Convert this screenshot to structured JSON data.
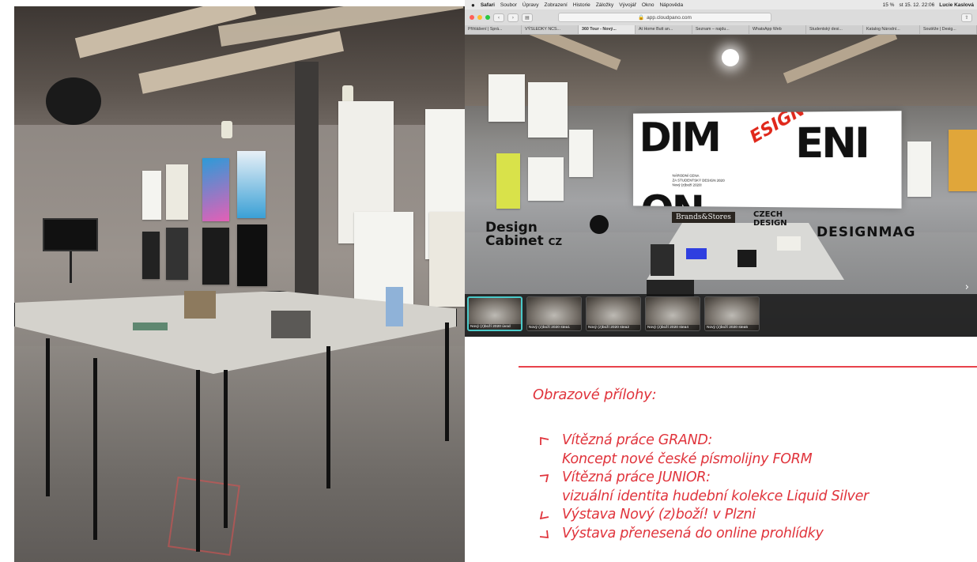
{
  "browser": {
    "menubar": {
      "apple": "",
      "app": "Safari",
      "items": [
        "Soubor",
        "Úpravy",
        "Zobrazení",
        "Historie",
        "Záložky",
        "Vývojář",
        "Okno",
        "Nápověda"
      ],
      "status": [
        "15 %",
        "st 15. 12.  22:06",
        "Lucie Kaslová"
      ]
    },
    "url": "app.cloudpano.com",
    "tabs": [
      "Přihlášení | Sprá...",
      "VÝSLEDKY NCS...",
      "360 Tour - Nový...",
      "At Home Butt an...",
      "Seznam – najdu...",
      "WhatsApp Web",
      "Studentský desi...",
      "Katalog Národní...",
      "Soutěže | Desig..."
    ],
    "active_tab": 2
  },
  "tour": {
    "banner_big_1": "DIM",
    "banner_big_2": "ENI",
    "banner_big_3": "ON",
    "banner_red": "ESIGN",
    "banner_small": "NÁRODNÍ CENA\nZA STUDENTSKÝ DESIGN 2020\nNový (z)boží 2020!",
    "logos": {
      "design_cabinet_1": "Design",
      "design_cabinet_2": "Cabinet",
      "design_cabinet_cz": "CZ",
      "brands_stores": "Brands&Stores",
      "czech_design_1": "CZECH",
      "czech_design_2": "DESIGN",
      "designmag": "DESIGNMAG"
    },
    "thumbnails": [
      "Nový (z)boží 2020 úvod",
      "Nový (z)boží 2020 stea1",
      "Nový (z)boží 2020 stea2",
      "Nový (z)boží 2020 stea4",
      "Nový (z)boží 2020 stea5"
    ],
    "next_icon": "chevron-right-icon"
  },
  "caption": {
    "title": "Obrazové přílohy:",
    "items": [
      {
        "lines": [
          "Vítězná práce GRAND:",
          "Koncept nové české písmolijny FORM"
        ],
        "marker": "corner-top-left"
      },
      {
        "lines": [
          "Vítězná práce JUNIOR:",
          "vizuální identita hudební kolekce Liquid Silver"
        ],
        "marker": "corner-top-right"
      },
      {
        "lines": [
          "Výstava Nový (z)boží! v Plzni"
        ],
        "marker": "corner-bottom-left"
      },
      {
        "lines": [
          "Výstava přenesená do online prohlídky"
        ],
        "marker": "corner-bottom-right"
      }
    ]
  },
  "colors": {
    "accent_red": "#e0343c",
    "rule_red": "#e8424b",
    "thumb_active": "#4ac9c9"
  }
}
